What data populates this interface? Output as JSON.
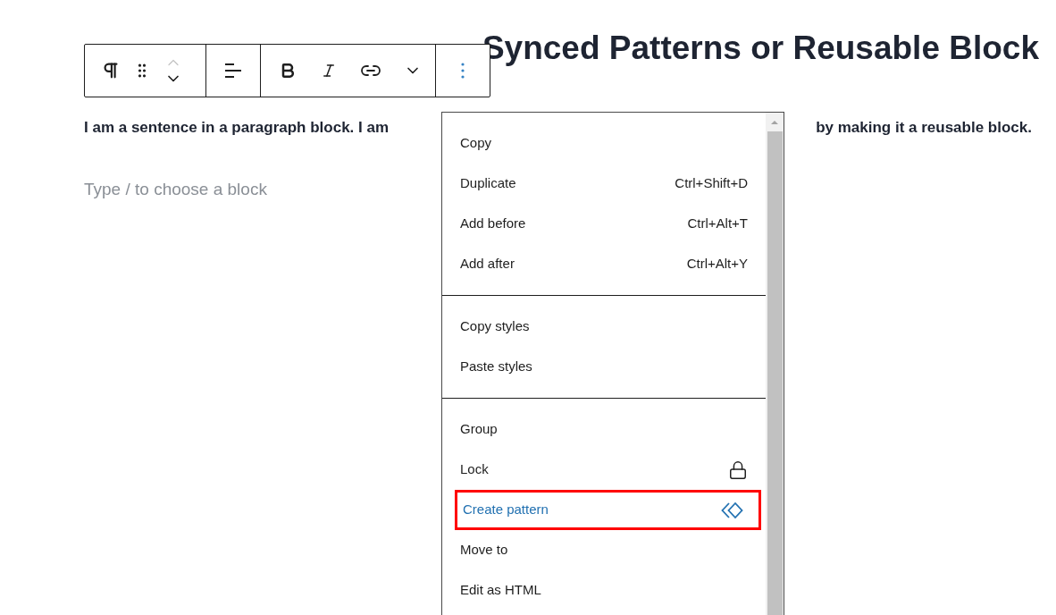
{
  "title": "Synced Patterns or Reusable Block",
  "paragraph": {
    "start": "I am a sentence in a paragraph block. I am",
    "end": "by making it a reusable block."
  },
  "block_placeholder": "Type / to choose a block",
  "toolbar": {
    "move_up": {
      "disabled": true
    },
    "move_down": {
      "disabled": false
    }
  },
  "menu": {
    "groups": [
      {
        "items": [
          {
            "label": "Copy",
            "highlighted": false
          },
          {
            "label": "Duplicate",
            "shortcut": "Ctrl+Shift+D",
            "highlighted": false
          },
          {
            "label": "Add before",
            "shortcut": "Ctrl+Alt+T",
            "highlighted": false
          },
          {
            "label": "Add after",
            "shortcut": "Ctrl+Alt+Y",
            "highlighted": false
          }
        ]
      },
      {
        "items": [
          {
            "label": "Copy styles",
            "highlighted": false
          },
          {
            "label": "Paste styles",
            "highlighted": false
          }
        ]
      },
      {
        "items": [
          {
            "label": "Group",
            "highlighted": false
          },
          {
            "label": "Lock",
            "kind": "lock",
            "highlighted": false
          },
          {
            "label": "Create pattern",
            "kind": "pattern",
            "highlighted": true
          },
          {
            "label": "Move to",
            "highlighted": false
          },
          {
            "label": "Edit as HTML",
            "highlighted": false
          }
        ]
      }
    ]
  }
}
